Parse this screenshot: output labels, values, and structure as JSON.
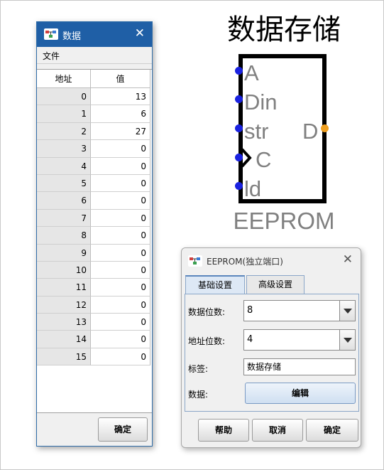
{
  "memory_window": {
    "title": "数据",
    "menu": [
      "文件"
    ],
    "columns": [
      "地址",
      "值"
    ],
    "rows": [
      {
        "addr": "0",
        "val": "13"
      },
      {
        "addr": "1",
        "val": "6"
      },
      {
        "addr": "2",
        "val": "27"
      },
      {
        "addr": "3",
        "val": "0"
      },
      {
        "addr": "4",
        "val": "0"
      },
      {
        "addr": "5",
        "val": "0"
      },
      {
        "addr": "6",
        "val": "0"
      },
      {
        "addr": "7",
        "val": "0"
      },
      {
        "addr": "8",
        "val": "0"
      },
      {
        "addr": "9",
        "val": "0"
      },
      {
        "addr": "10",
        "val": "0"
      },
      {
        "addr": "11",
        "val": "0"
      },
      {
        "addr": "12",
        "val": "0"
      },
      {
        "addr": "13",
        "val": "0"
      },
      {
        "addr": "14",
        "val": "0"
      },
      {
        "addr": "15",
        "val": "0"
      }
    ],
    "ok_label": "确定",
    "close_icon": "close-icon",
    "title_bar_color": "#1f5fa6"
  },
  "component": {
    "title": "数据存储",
    "subtitle": "EEPROM",
    "pins": {
      "a": "A",
      "din": "Din",
      "str": "str",
      "c": "C",
      "ld": "ld",
      "d": "D"
    },
    "input_pin_color": "#1a22e0",
    "output_pin_color": "#f0a020"
  },
  "dialog": {
    "title": "EEPROM(独立端口)",
    "tabs": [
      "基础设置",
      "高级设置"
    ],
    "fields": {
      "data_bits_label": "数据位数:",
      "data_bits_value": "8",
      "addr_bits_label": "地址位数:",
      "addr_bits_value": "4",
      "label_label": "标签:",
      "label_value": "数据存储",
      "data_label": "数据:",
      "edit_label": "编辑"
    },
    "buttons": {
      "help": "帮助",
      "cancel": "取消",
      "ok": "确定"
    }
  }
}
